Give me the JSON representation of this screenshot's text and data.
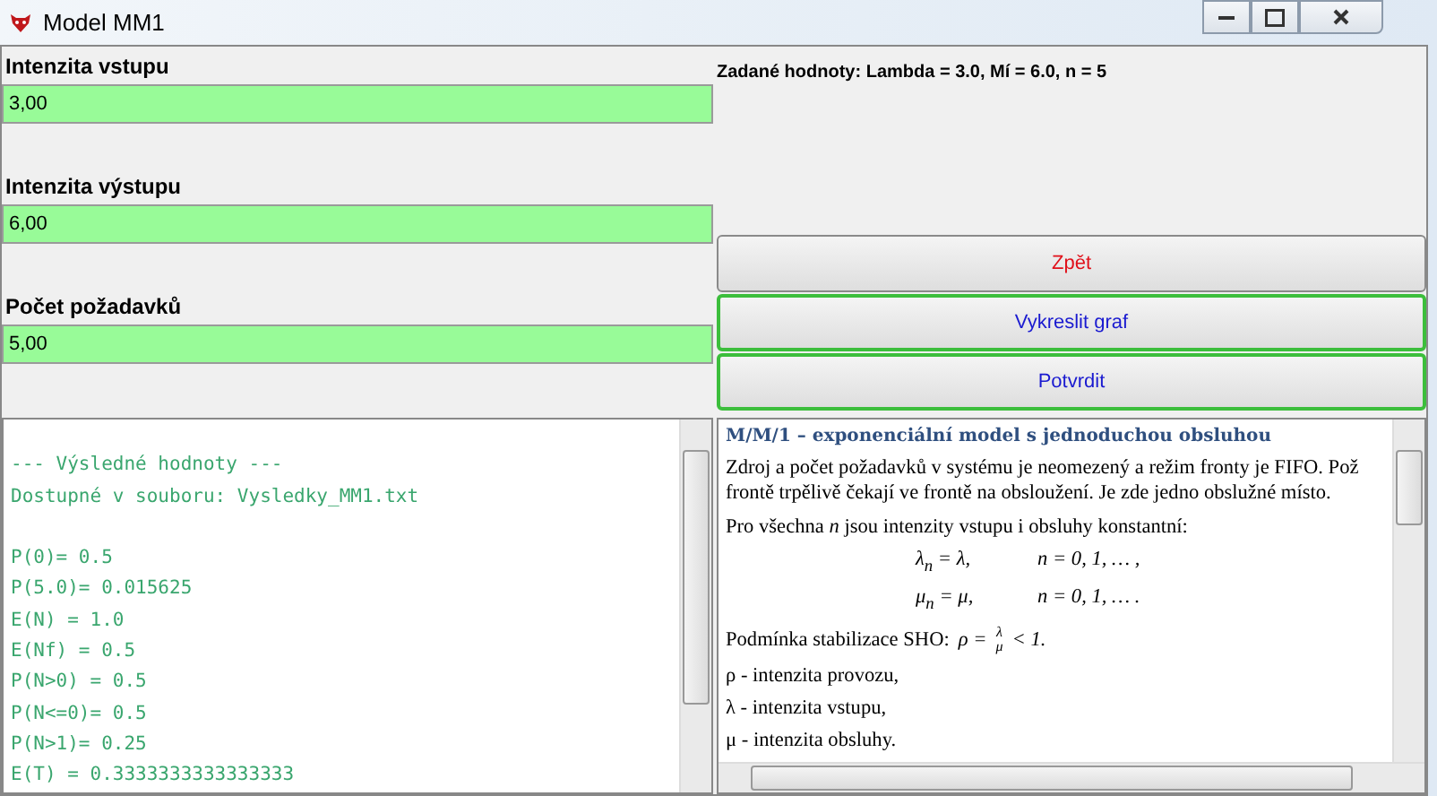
{
  "window": {
    "title": "Model MM1"
  },
  "inputs": [
    {
      "label": "Intenzita vstupu",
      "value": "3,00"
    },
    {
      "label": "Intenzita výstupu",
      "value": "6,00"
    },
    {
      "label": "Počet požadavků",
      "value": "5,00"
    }
  ],
  "given_values": "Zadané hodnoty: Lambda = 3.0, Mí = 6.0, n = 5",
  "buttons": [
    {
      "label": "Zpět",
      "kind": "back",
      "focused": false
    },
    {
      "label": "Vykreslit graf",
      "kind": "action",
      "focused": true
    },
    {
      "label": "Potvrdit",
      "kind": "action",
      "focused": true
    }
  ],
  "results": {
    "header_lines": [
      "--- Výsledné hodnoty ---",
      "Dostupné v souboru: Vysledky_MM1.txt"
    ],
    "lines": [
      "P(0)= 0.5",
      "P(5.0)= 0.015625",
      "E(N) = 1.0",
      "E(Nf) = 0.5",
      "P(N>0) = 0.5",
      "P(N<=0)= 0.5",
      "P(N>1)= 0.25",
      "E(T) = 0.3333333333333333"
    ]
  },
  "description": {
    "heading": "M/M/1 – exponenciální model s jednoduchou obsluhou",
    "intro_lines": [
      "Zdroj a počet požadavků v systému je neomezený a režim fronty je FIFO. Pož",
      "frontě trpělivě čekají ve frontě na obsloužení. Je zde jedno obslužné místo."
    ],
    "constant_text": "Pro všechna *n* jsou intenzity vstupu i obsluhy konstantní:",
    "equations": [
      {
        "left": "λ$_{n}$ = λ,",
        "right": "n = 0, 1, … ,"
      },
      {
        "left": "μ$_{n}$ = μ,",
        "right": "n = 0, 1, … ."
      }
    ],
    "condition": {
      "label": "Podmínka stabilizace SHO:",
      "lhs": "ρ =",
      "numerator": "λ",
      "denominator": "μ",
      "rhs": "< 1."
    },
    "symbols": [
      "ρ - intenzita provozu,",
      "λ - intenzita vstupu,",
      "μ - intenzita obsluhy."
    ]
  }
}
